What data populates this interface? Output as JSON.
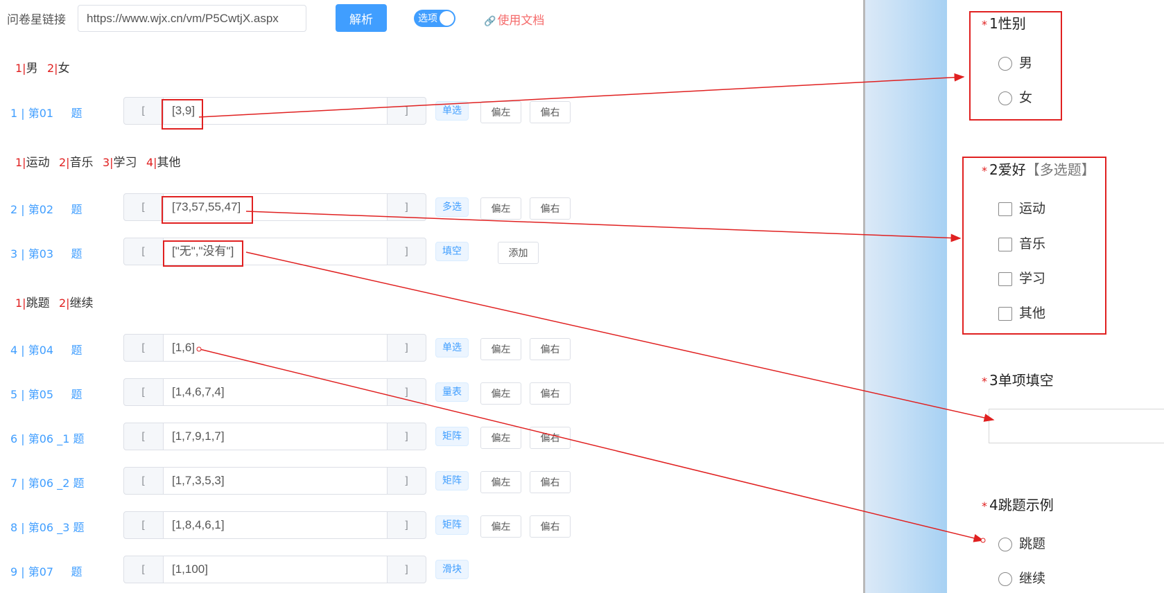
{
  "topbar": {
    "label": "问卷星链接",
    "url_value": "https://www.wjx.cn/vm/P5CwtjX.aspx",
    "parse_label": "解析",
    "toggle_label": "选项",
    "doc_link": "使用文档",
    "accent": "#409eff"
  },
  "option_lines": [
    {
      "items": [
        {
          "num": "1|",
          "text": "男"
        },
        {
          "num": "2|",
          "text": "女"
        }
      ]
    },
    {
      "items": [
        {
          "num": "1|",
          "text": "运动"
        },
        {
          "num": "2|",
          "text": "音乐"
        },
        {
          "num": "3|",
          "text": "学习"
        },
        {
          "num": "4|",
          "text": "其他"
        }
      ]
    },
    {
      "items": [
        {
          "num": "1|",
          "text": "跳题"
        },
        {
          "num": "2|",
          "text": "继续"
        }
      ]
    }
  ],
  "questions": [
    {
      "label": "1 | 第01     题",
      "pre": "[",
      "value": "[3,9]",
      "post": "]",
      "tag": "单选",
      "buttons": [
        "偏左",
        "偏右"
      ]
    },
    {
      "label": "2 | 第02     题",
      "pre": "[",
      "value": "[73,57,55,47]",
      "post": "]",
      "tag": "多选",
      "buttons": [
        "偏左",
        "偏右"
      ]
    },
    {
      "label": "3 | 第03     题",
      "pre": "[",
      "value": "[\"无\",\"没有\"]",
      "post": "]",
      "tag": "填空",
      "buttons": [
        "添加"
      ]
    },
    {
      "label": "4 | 第04     题",
      "pre": "[",
      "value": "[1,6]",
      "post": "]",
      "tag": "单选",
      "buttons": [
        "偏左",
        "偏右"
      ]
    },
    {
      "label": "5 | 第05     题",
      "pre": "[",
      "value": "[1,4,6,7,4]",
      "post": "]",
      "tag": "量表",
      "buttons": [
        "偏左",
        "偏右"
      ]
    },
    {
      "label": "6 | 第06 _1 题",
      "pre": "[",
      "value": "[1,7,9,1,7]",
      "post": "]",
      "tag": "矩阵",
      "buttons": [
        "偏左",
        "偏右"
      ]
    },
    {
      "label": "7 | 第06 _2 题",
      "pre": "[",
      "value": "[1,7,3,5,3]",
      "post": "]",
      "tag": "矩阵",
      "buttons": [
        "偏左",
        "偏右"
      ]
    },
    {
      "label": "8 | 第06 _3 题",
      "pre": "[",
      "value": "[1,8,4,6,1]",
      "post": "]",
      "tag": "矩阵",
      "buttons": [
        "偏左",
        "偏右"
      ]
    },
    {
      "label": "9 | 第07     题",
      "pre": "[",
      "value": "[1,100]",
      "post": "]",
      "tag": "滑块",
      "buttons": []
    }
  ],
  "survey": {
    "q1": {
      "star": "*",
      "title": "1性别",
      "options": [
        "男",
        "女"
      ]
    },
    "q2": {
      "star": "*",
      "title": "2爱好",
      "sub": "【多选题】",
      "options": [
        "运动",
        "音乐",
        "学习",
        "其他"
      ]
    },
    "q3": {
      "star": "*",
      "title": "3单项填空"
    },
    "q4": {
      "star": "*",
      "title": "4跳题示例",
      "options": [
        "跳题",
        "继续"
      ]
    }
  },
  "annotation_color": "#e02020"
}
